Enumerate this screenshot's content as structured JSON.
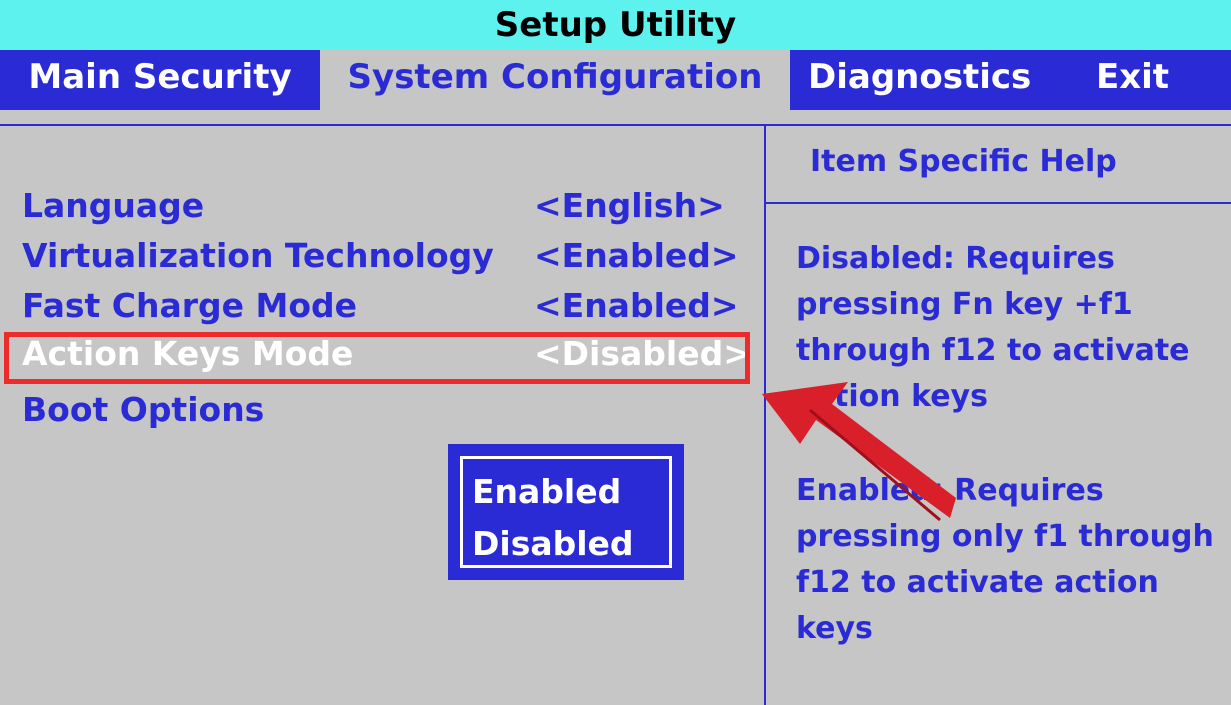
{
  "window": {
    "title": "Setup Utility"
  },
  "menu": {
    "tabs": [
      {
        "label": "Main Security"
      },
      {
        "label": "System Configuration"
      },
      {
        "label": "Diagnostics"
      },
      {
        "label": "Exit"
      }
    ]
  },
  "settings": [
    {
      "label": "Language",
      "value": "<English>"
    },
    {
      "label": "Virtualization Technology",
      "value": "<Enabled>"
    },
    {
      "label": "Fast Charge Mode",
      "value": "<Enabled>"
    },
    {
      "label": "Action Keys Mode",
      "value": "<Disabled>"
    },
    {
      "label": "Boot Options",
      "value": ""
    }
  ],
  "popup": {
    "options": [
      {
        "label": "Enabled"
      },
      {
        "label": "Disabled"
      }
    ]
  },
  "help": {
    "title": "Item Specific Help",
    "paragraphs": [
      "Disabled: Requires\npressing Fn key +f1\nthrough f12 to activate\naction keys",
      "Enabled: Requires\npressing only f1 through\nf12 to activate action\nkeys"
    ]
  },
  "colors": {
    "title_bar": "#5ef2ee",
    "menu_bar": "#2b2bd6",
    "background": "#c6c6c6",
    "text": "#2b2bd6",
    "selected_text": "#ffffff",
    "annotation": "#ee2b2b"
  },
  "icons": {
    "annotation_arrow": "red-arrow-icon"
  }
}
